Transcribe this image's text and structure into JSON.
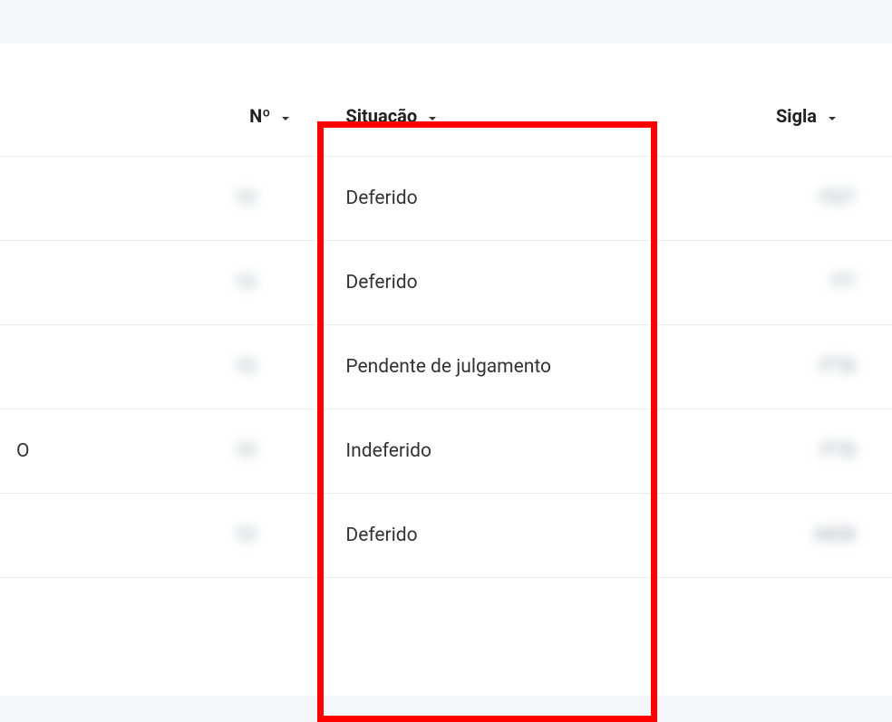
{
  "headers": {
    "numero": "Nº",
    "situacao": "Situação",
    "sigla": "Sigla"
  },
  "rows": [
    {
      "prefix": "",
      "numero": "10",
      "situacao": "Deferido",
      "sigla": "PDT"
    },
    {
      "prefix": "",
      "numero": "10",
      "situacao": "Deferido",
      "sigla": "PT"
    },
    {
      "prefix": "",
      "numero": "10",
      "situacao": "Pendente de julgamento",
      "sigla": "PTB"
    },
    {
      "prefix": "O",
      "numero": "10",
      "situacao": "Indeferido",
      "sigla": "PTB"
    },
    {
      "prefix": "",
      "numero": "10",
      "situacao": "Deferido",
      "sigla": "MDB"
    }
  ]
}
